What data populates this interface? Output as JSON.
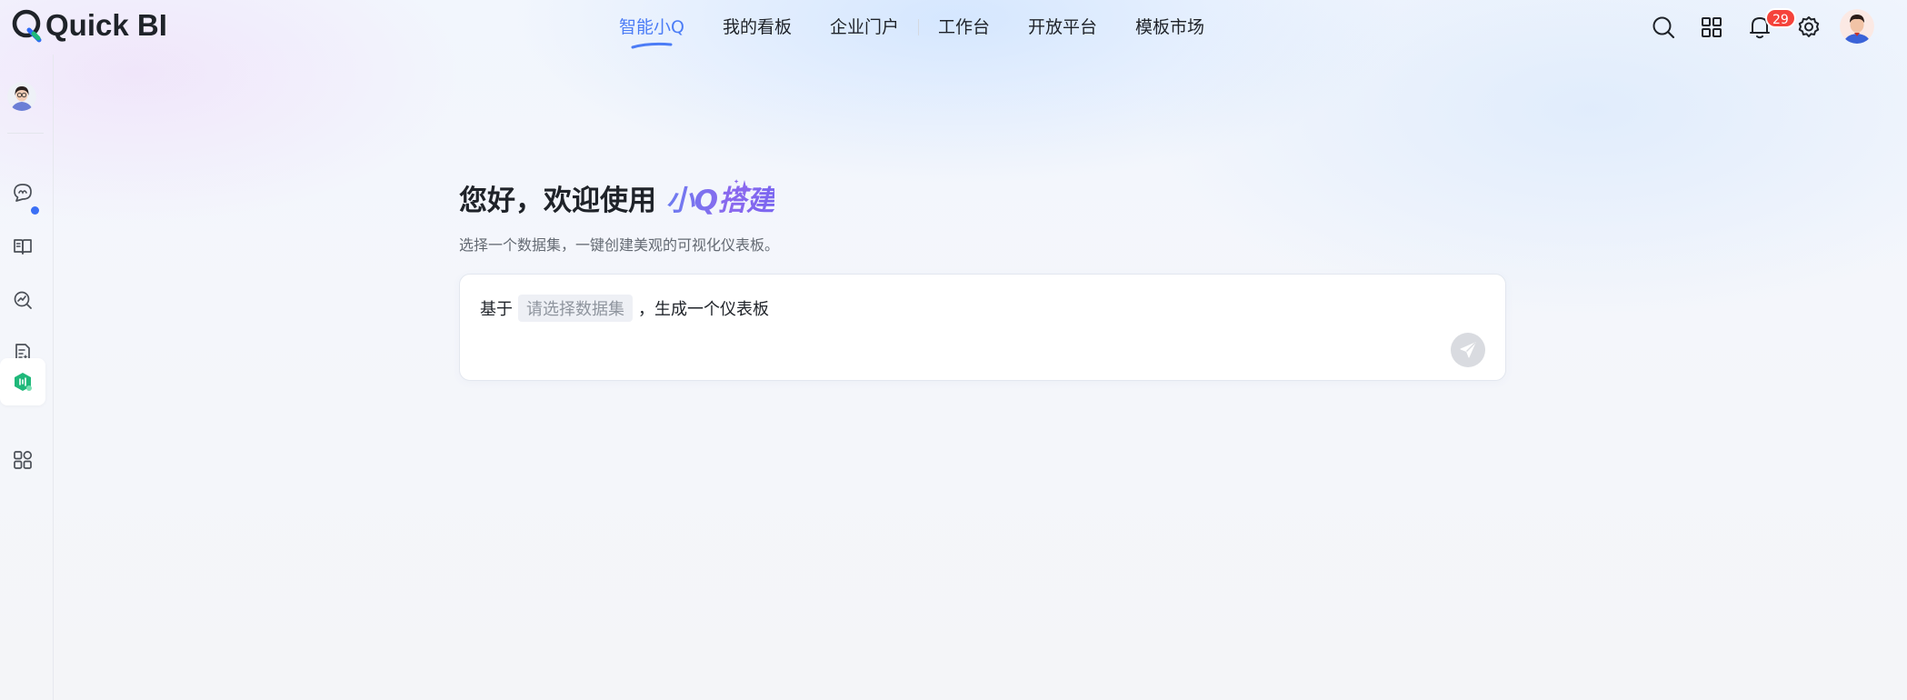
{
  "app": {
    "logo_text": "Quick BI"
  },
  "nav": {
    "items": [
      {
        "label": "智能小Q",
        "active": true
      },
      {
        "label": "我的看板",
        "active": false
      },
      {
        "label": "企业门户",
        "active": false
      },
      {
        "label": "工作台",
        "active": false
      },
      {
        "label": "开放平台",
        "active": false
      },
      {
        "label": "模板市场",
        "active": false
      }
    ]
  },
  "header_actions": {
    "icons": [
      "search-icon",
      "apps-grid-icon",
      "bell-icon",
      "gear-icon"
    ],
    "notification_count": "29"
  },
  "sidebar": {
    "items": [
      {
        "icon": "chat-icon",
        "active": false
      },
      {
        "icon": "book-icon",
        "active": false,
        "dot": true
      },
      {
        "icon": "analysis-icon",
        "active": false
      },
      {
        "icon": "report-icon",
        "active": false
      },
      {
        "icon": "build-icon",
        "active": true
      },
      {
        "icon": "apps-icon",
        "active": false
      }
    ]
  },
  "main": {
    "greeting_prefix": "您好，欢迎使用 ",
    "greeting_brand": "小Q搭建",
    "subtitle": "选择一个数据集，一键创建美观的可视化仪表板。",
    "prompt_prefix": "基于",
    "dataset_placeholder": "请选择数据集",
    "prompt_suffix": "，生成一个仪表板"
  },
  "colors": {
    "accent": "#4b7cf6",
    "brand_gradient_start": "#6d7cf0",
    "brand_gradient_end": "#8a68ee",
    "badge": "#f5433b",
    "active_sidebar_icon": "#1fb87a"
  }
}
